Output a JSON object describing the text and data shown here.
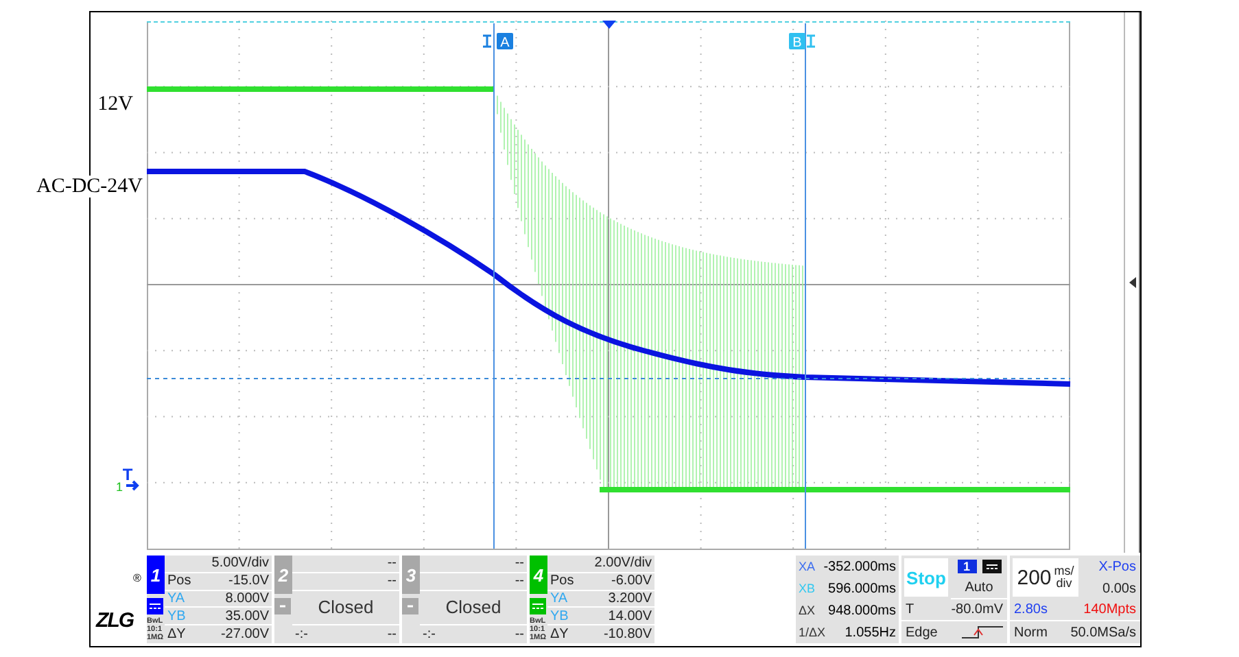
{
  "labels": [
    {
      "text": "12V"
    },
    {
      "text": "AC-DC-24V"
    }
  ],
  "cursors": [
    {
      "label": "A"
    },
    {
      "label": "B"
    }
  ],
  "trigger_marker": {
    "label": "T",
    "channel": "1"
  },
  "logo": {
    "text": "ZLG",
    "mark": "®"
  },
  "channels": [
    {
      "number": "1",
      "kind": "open",
      "color": "#0000ff",
      "scale": "5.00V/div",
      "pos_label": "Pos",
      "pos": "-15.0V",
      "ya_label": "YA",
      "ya": "8.000V",
      "yb_label": "YB",
      "yb": "35.00V",
      "dy_label": "ΔY",
      "dy": "-27.00V",
      "flags": [
        "BwL",
        "10:1",
        "1MΩ"
      ]
    },
    {
      "number": "2",
      "kind": "closed",
      "color": "#a8a8a8",
      "scale": "--",
      "pos": "--",
      "status": "Closed",
      "footer_left": "-:-",
      "footer": "--"
    },
    {
      "number": "3",
      "kind": "closed",
      "color": "#a8a8a8",
      "scale": "--",
      "pos": "--",
      "status": "Closed",
      "footer_left": "-:-",
      "footer": "--"
    },
    {
      "number": "4",
      "kind": "open",
      "color": "#00c000",
      "scale": "2.00V/div",
      "pos_label": "Pos",
      "pos": "-6.00V",
      "ya_label": "YA",
      "ya": "3.200V",
      "yb_label": "YB",
      "yb": "14.00V",
      "dy_label": "ΔY",
      "dy": "-10.80V",
      "flags": [
        "BwL",
        "10:1",
        "1MΩ"
      ]
    }
  ],
  "cursor_readout": [
    {
      "label": "XA",
      "value": "-352.000ms",
      "color": "#3a6cf0"
    },
    {
      "label": "XB",
      "value": "596.000ms",
      "color": "#30c8f0"
    },
    {
      "label": "ΔX",
      "value": "948.000ms",
      "color": "#333333"
    },
    {
      "label": "1/ΔX",
      "value": "1.055Hz",
      "color": "#333333"
    }
  ],
  "run": {
    "state": "Stop",
    "source": "1",
    "mode": "Auto",
    "trigger_label": "T",
    "trigger_level": "-80.0mV",
    "trigger_type": "Edge"
  },
  "timebase": {
    "value": "200",
    "unit_top": "ms/",
    "unit_bottom": "div",
    "xpos_label": "X-Pos",
    "xpos": "0.00s",
    "duration": "2.80s",
    "points": "140Mpts",
    "mode": "Norm",
    "rate": "50.0MSa/s"
  }
}
